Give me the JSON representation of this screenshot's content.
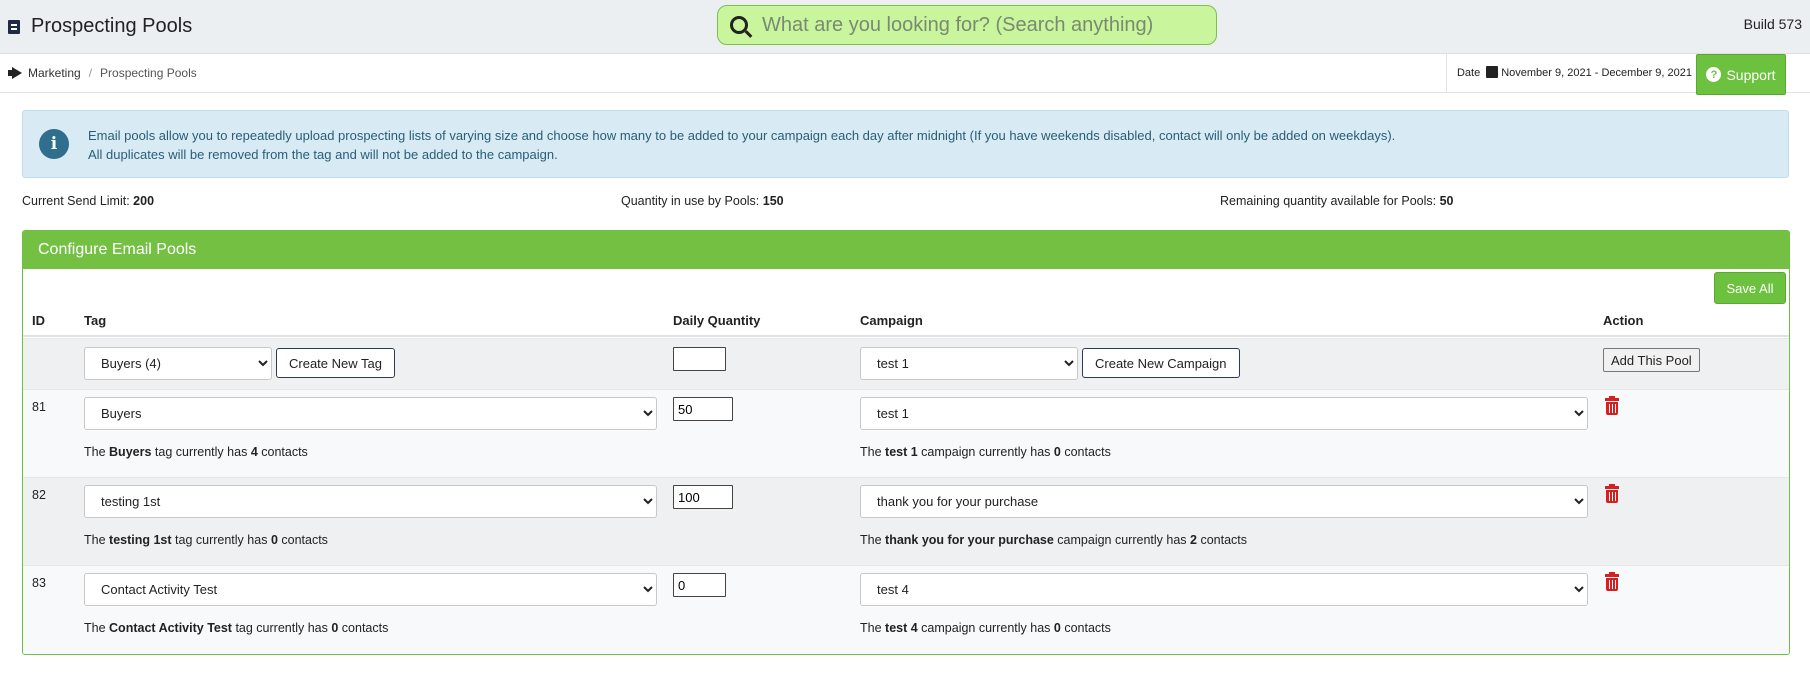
{
  "app": {
    "title": "Prospecting Pools",
    "build": "Build 573"
  },
  "search": {
    "placeholder": "What are you looking for? (Search anything)"
  },
  "breadcrumb": {
    "root": "Marketing",
    "separator": "/",
    "current": "Prospecting Pools"
  },
  "date_filter": {
    "label": "Date",
    "range": "November 9, 2021 - December 9, 2021"
  },
  "support": {
    "label": "Support"
  },
  "alert": {
    "line1": "Email pools allow you to repeatedly upload prospecting lists of varying size and choose how many to be added to your campaign each day after midnight (If you have weekends disabled, contact will only be added on weekdays).",
    "line2": "All duplicates will be removed from the tag and will not be added to the campaign."
  },
  "stats": {
    "send_limit_label": "Current Send Limit:",
    "send_limit": "200",
    "in_use_label": "Quantity in use by Pools:",
    "in_use": "150",
    "remaining_label": "Remaining quantity available for Pools:",
    "remaining": "50"
  },
  "card": {
    "title": "Configure Email Pools",
    "save_all": "Save All"
  },
  "columns": {
    "id": "ID",
    "tag": "Tag",
    "daily_quantity": "Daily Quantity",
    "campaign": "Campaign",
    "action": "Action"
  },
  "new_row": {
    "tag_value": "Buyers (4)",
    "create_tag": "Create New Tag",
    "quantity": "",
    "campaign_value": "test 1",
    "create_campaign": "Create New Campaign",
    "add_pool": "Add This Pool"
  },
  "pools": [
    {
      "id": "81",
      "tag": "Buyers",
      "quantity": "50",
      "campaign": "test 1",
      "tag_note": {
        "pre": "The",
        "name": "Buyers",
        "mid": "tag currently has",
        "count": "4",
        "post": "contacts"
      },
      "campaign_note": {
        "pre": "The",
        "name": "test 1",
        "mid": "campaign currently has",
        "count": "0",
        "post": "contacts"
      }
    },
    {
      "id": "82",
      "tag": "testing 1st",
      "quantity": "100",
      "campaign": "thank you for your purchase",
      "tag_note": {
        "pre": "The",
        "name": "testing 1st",
        "mid": "tag currently has",
        "count": "0",
        "post": "contacts"
      },
      "campaign_note": {
        "pre": "The",
        "name": "thank you for your purchase",
        "mid": "campaign currently has",
        "count": "2",
        "post": "contacts"
      }
    },
    {
      "id": "83",
      "tag": "Contact Activity Test",
      "quantity": "0",
      "campaign": "test 4",
      "tag_note": {
        "pre": "The",
        "name": "Contact Activity Test",
        "mid": "tag currently has",
        "count": "0",
        "post": "contacts"
      },
      "campaign_note": {
        "pre": "The",
        "name": "test 4",
        "mid": "campaign currently has",
        "count": "0",
        "post": "contacts"
      }
    }
  ],
  "colors": {
    "brand_green": "#74c043",
    "search_bg": "#c9f59c",
    "alert_bg": "#d8ebf4",
    "delete_red": "#d62020"
  }
}
